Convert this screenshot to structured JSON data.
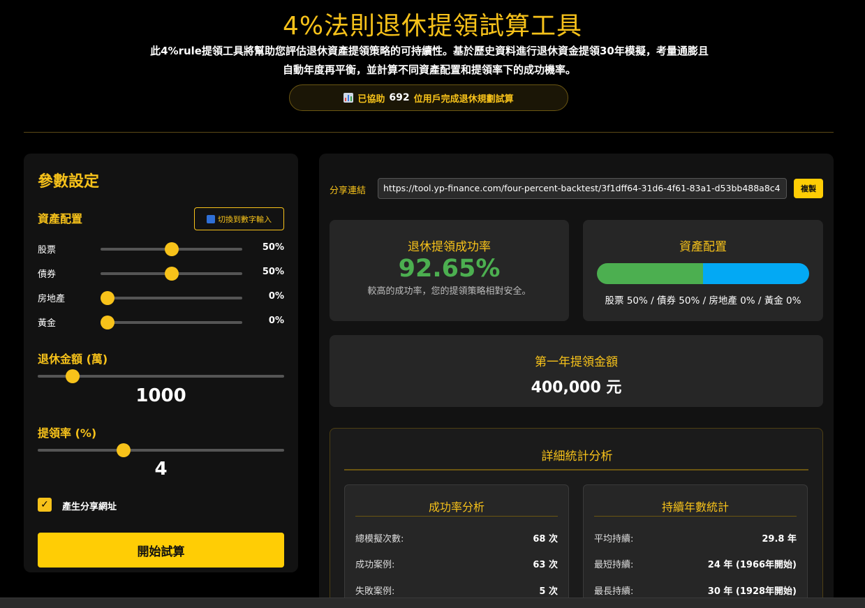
{
  "header": {
    "title": "4%法則退休提領試算工具",
    "subtitle": "此4%rule提領工具將幫助您評估退休資產提領策略的可持續性。基於歷史資料進行退休資金提領30年模擬，考量通膨且自動年度再平衡，並計算不同資產配置和提領率下的成功機率。",
    "users_prefix": "已協助",
    "users_count": "692",
    "users_suffix": "位用戶完成退休規劃試算",
    "icon": "bar-chart-emoji-icon"
  },
  "settings": {
    "title": "參數設定",
    "allocation_title": "資產配置",
    "switch_label": "切換到數字輸入",
    "assets": [
      {
        "label": "股票",
        "value": "50%",
        "level": 0.5
      },
      {
        "label": "債券",
        "value": "50%",
        "level": 0.5
      },
      {
        "label": "房地產",
        "value": "0%",
        "level": 0
      },
      {
        "label": "黃金",
        "value": "0%",
        "level": 0
      }
    ],
    "retire_amount_title": "退休金額 (萬)",
    "retire_amount": "1000",
    "retire_amount_level": 0.12,
    "rate_title": "提領率 (%)",
    "rate": "4",
    "rate_level": 0.34,
    "share_checkbox_label": "產生分享網址",
    "share_checked": true,
    "start_label": "開始試算"
  },
  "results": {
    "share_label": "分享連結",
    "share_url": "https://tool.yp-finance.com/four-percent-backtest/3f1dff64-31d6-4f61-83a1-d53bb488a8c4",
    "copy_label": "複製",
    "success_title": "退休提領成功率",
    "success_rate": "92.65%",
    "success_note": "較高的成功率，您的提領策略相對安全。",
    "allocation_title": "資產配置",
    "allocation_summary": "股票 50% / 債券 50% / 房地產 0% / 黃金 0%",
    "allocation_split": [
      {
        "name": "股票",
        "share": 0.5,
        "color": "#4caf50"
      },
      {
        "name": "債券",
        "share": 0.5,
        "color": "#03a9f4"
      }
    ],
    "first_year_title": "第一年提領金額",
    "first_year_amount": "400,000 元",
    "detail_title": "詳細統計分析",
    "success_analysis": {
      "title": "成功率分析",
      "rows": [
        {
          "k": "總模擬次數:",
          "v": "68 次"
        },
        {
          "k": "成功案例:",
          "v": "63 次"
        },
        {
          "k": "失敗案例:",
          "v": "5 次"
        }
      ]
    },
    "duration_stats": {
      "title": "持續年數統計",
      "rows": [
        {
          "k": "平均持續:",
          "v": "29.8 年"
        },
        {
          "k": "最短持續:",
          "v": "24 年 (1966年開始)"
        },
        {
          "k": "最長持續:",
          "v": "30 年 (1928年開始)"
        }
      ]
    }
  },
  "colors": {
    "accent": "#f7c21a",
    "success": "#4caf50",
    "bond": "#03a9f4",
    "button": "#ffcd05"
  }
}
